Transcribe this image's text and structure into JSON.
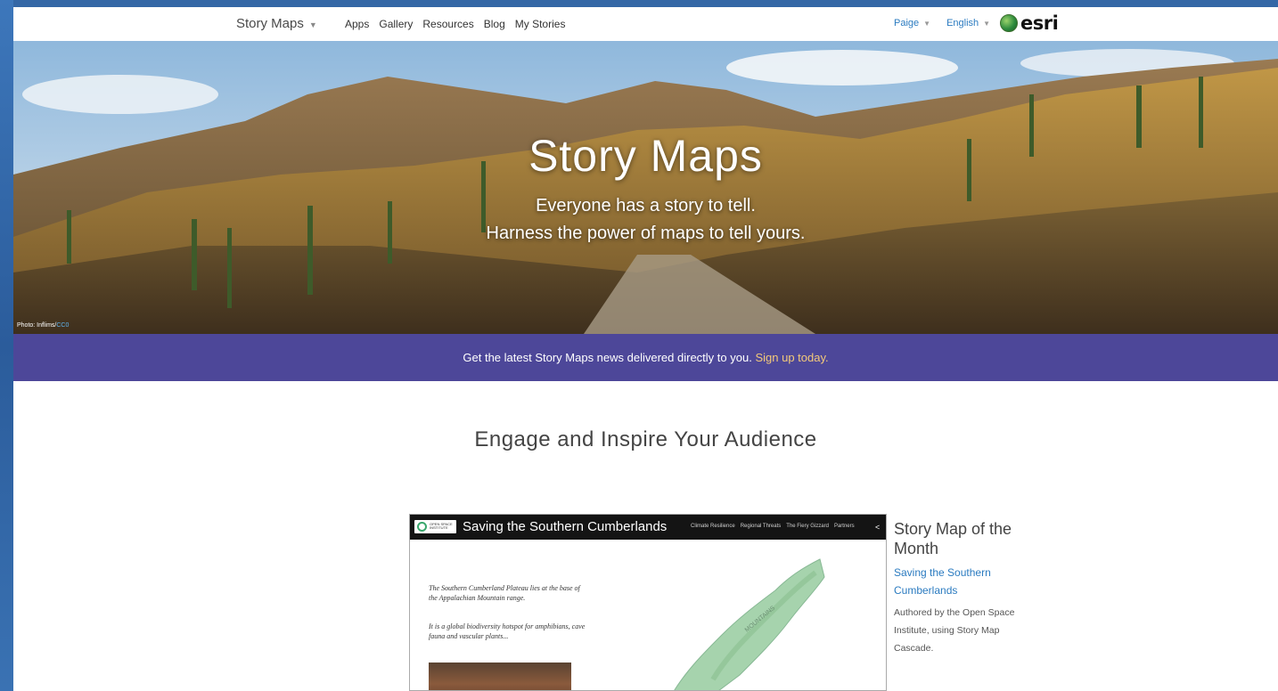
{
  "nav": {
    "brand": "Story Maps",
    "links": [
      "Apps",
      "Gallery",
      "Resources",
      "Blog",
      "My Stories"
    ],
    "user": "Paige",
    "language": "English",
    "logo_text": "esri"
  },
  "hero": {
    "title": "Story Maps",
    "subtitle1": "Everyone has a story to tell.",
    "subtitle2": "Harness the power of maps to tell yours.",
    "photo_credit": "Photo: Inflims/",
    "photo_license": "CC0"
  },
  "banner": {
    "text": "Get the latest Story Maps news delivered directly to you.",
    "link": "Sign up today."
  },
  "section": {
    "heading": "Engage and Inspire Your Audience"
  },
  "featured_card": {
    "logo_text": "OPEN SPACE INSTITUTE",
    "title": "Saving the Southern Cumberlands",
    "tabs": [
      "Climate Resilience",
      "Regional Threats",
      "The Fiery Gizzard",
      "Partners"
    ],
    "paragraph1": "The Southern Cumberland Plateau lies at the base of the Appalachian Mountain range.",
    "paragraph2": "It is a global biodiversity hotspot for amphibians, cave fauna and vascular plants...",
    "map_label": "MOUNTAINS"
  },
  "story_of_month": {
    "title": "Story Map of the Month",
    "link": "Saving the Southern Cumberlands",
    "description": "Authored by the Open Space Institute, using Story Map Cascade."
  },
  "colors": {
    "banner": "#4d4799",
    "link": "#2b7bc0",
    "banner_link": "#f3c97a"
  }
}
